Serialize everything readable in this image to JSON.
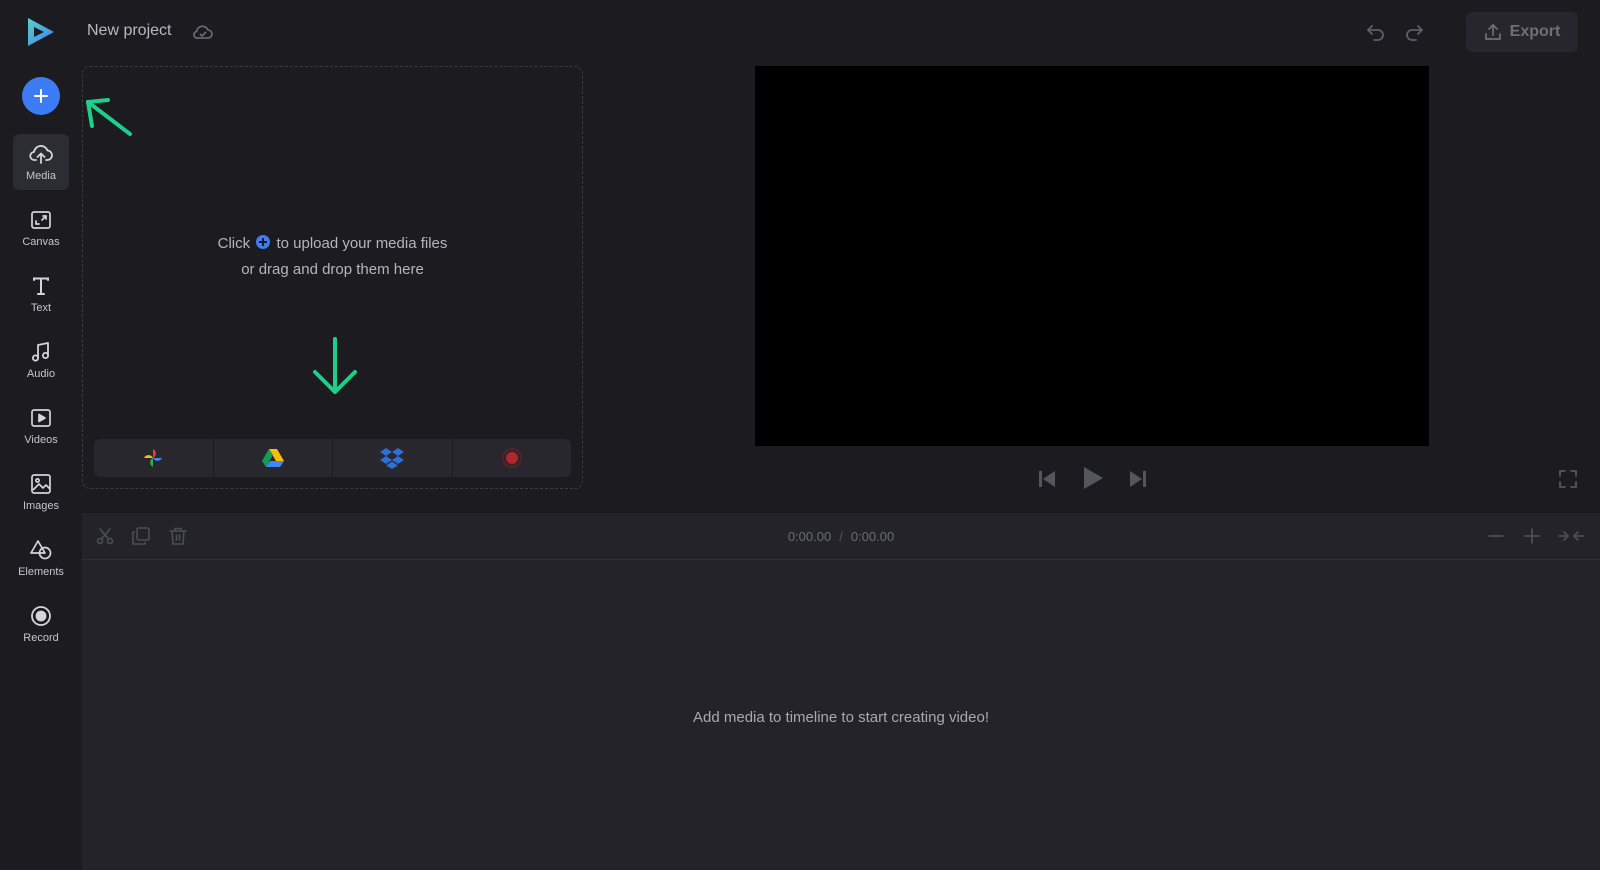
{
  "app": {
    "project_title": "New project",
    "export_label": "Export"
  },
  "sidebar": {
    "items": [
      {
        "label": "Media",
        "icon": "upload-cloud-icon",
        "active": true
      },
      {
        "label": "Canvas",
        "icon": "canvas-resize-icon"
      },
      {
        "label": "Text",
        "icon": "text-icon"
      },
      {
        "label": "Audio",
        "icon": "music-note-icon"
      },
      {
        "label": "Videos",
        "icon": "video-play-icon"
      },
      {
        "label": "Images",
        "icon": "image-icon"
      },
      {
        "label": "Elements",
        "icon": "shapes-icon"
      },
      {
        "label": "Record",
        "icon": "record-icon"
      }
    ]
  },
  "media_panel": {
    "upload_line1_before": "Click",
    "upload_line1_after": "to upload your media files",
    "upload_line2": "or drag and drop them here",
    "sources": [
      {
        "name": "google-photos-icon"
      },
      {
        "name": "google-drive-icon"
      },
      {
        "name": "dropbox-icon"
      },
      {
        "name": "record-screen-icon"
      }
    ]
  },
  "timeline": {
    "current_time": "0:00.00",
    "separator": "/",
    "total_time": "0:00.00",
    "empty_message": "Add media to timeline to start creating video!"
  },
  "colors": {
    "accent": "#3d7cf5",
    "hint_green": "#1ecf8a",
    "background": "#1b1b20",
    "panel": "#232329"
  }
}
